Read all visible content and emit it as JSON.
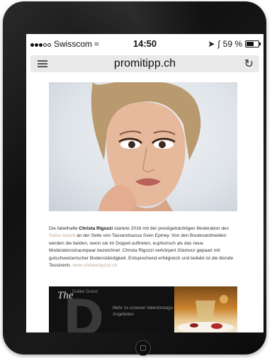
{
  "status_bar": {
    "carrier": "Swisscom",
    "time": "14:50",
    "battery": "59 %"
  },
  "browser": {
    "url": "promitipp.ch"
  },
  "article": {
    "t1": "Die fabelhafte ",
    "name": "Christa Rigozzi",
    "t2": " startete 2016 mit der prestigeträchtigen Moderation des ",
    "award_link": "Swiss Award",
    "t3": " an der Seite von Tausendsassa Sven Epiney. Von den Boulevardmedien werden die beiden, wenn sie im Doppel auftreten, euphorisch als das neue Moderationstraumpaar bezeichnet. Christa Rigozzi verkörpert Glamour gepaart mit gutschweizerischer Bodenständigkeit. Entsprechend erfolgreich und beliebt ist die blonde Tessinerin. ",
    "website_link": "www.christarigozzi.ch"
  },
  "banner": {
    "the": "The",
    "letter": "D",
    "brand_small": "Dolder Grand",
    "cta": "Mehr zu unseren Valentinstags-Angeboten"
  },
  "colors": {
    "link": "#c0a890",
    "banner_bg": "#111111"
  }
}
